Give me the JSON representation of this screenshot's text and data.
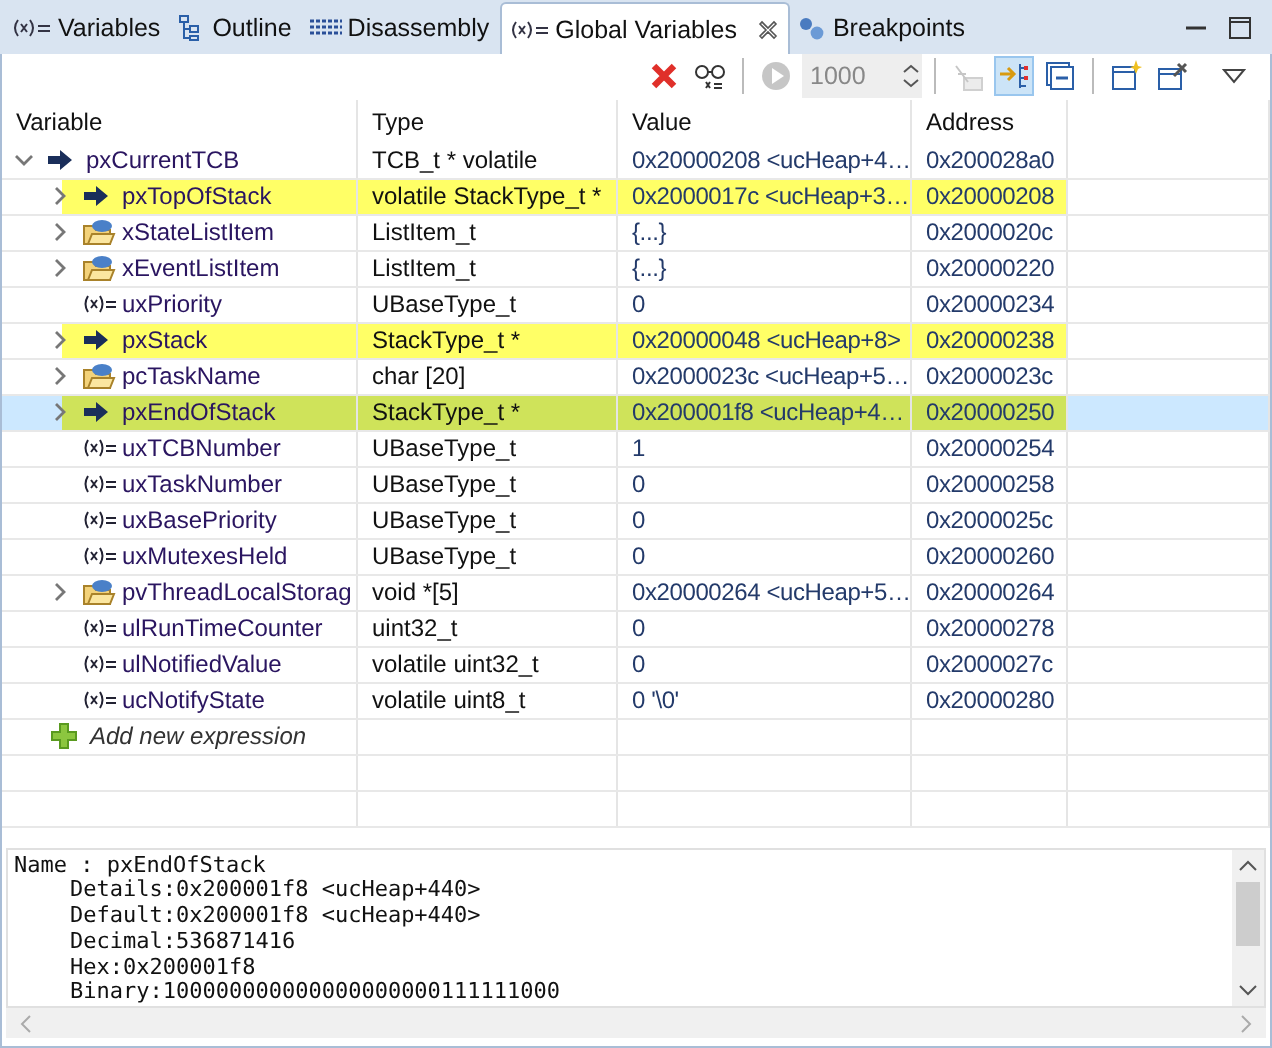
{
  "tabs": [
    {
      "label": "Variables",
      "selected": false
    },
    {
      "label": "Outline",
      "selected": false
    },
    {
      "label": "Disassembly",
      "selected": false
    },
    {
      "label": "Global Variables",
      "selected": true
    },
    {
      "label": "Breakpoints",
      "selected": false
    }
  ],
  "toolbar": {
    "groups": [
      [
        {
          "kind": "remove",
          "disabled": false
        },
        {
          "kind": "watch",
          "disabled": false
        }
      ],
      [
        {
          "kind": "play",
          "disabled": true
        },
        {
          "kind": "spinner",
          "value": "1000",
          "disabled": true
        }
      ],
      [
        {
          "kind": "filter",
          "disabled": true
        },
        {
          "kind": "layout",
          "disabled": false,
          "on": true
        },
        {
          "kind": "collapse",
          "disabled": false,
          "on": false
        }
      ],
      [
        {
          "kind": "new",
          "disabled": false
        },
        {
          "kind": "pin",
          "disabled": false
        }
      ]
    ]
  },
  "table": {
    "columns": [
      "Variable",
      "Type",
      "Value",
      "Address"
    ],
    "rows": [
      {
        "name": "pxCurrentTCB",
        "type": "TCB_t * volatile",
        "value": "0x20000208 <ucHeap+4…",
        "address": "0x200028a0",
        "kind": "pointer",
        "expanded": true,
        "selected": false,
        "children": [
          {
            "name": "pxTopOfStack",
            "type": "volatile StackType_t *",
            "value": "0x2000017c <ucHeap+3…",
            "address": "0x20000208",
            "kind": "pointer",
            "expanded": false,
            "selected": false,
            "color": "#ffff66"
          },
          {
            "name": "xStateListItem",
            "type": "ListItem_t",
            "value": "{...}",
            "address": "0x2000020c",
            "kind": "struct",
            "expanded": false,
            "selected": false
          },
          {
            "name": "xEventListItem",
            "type": "ListItem_t",
            "value": "{...}",
            "address": "0x20000220",
            "kind": "struct",
            "expanded": false,
            "selected": false
          },
          {
            "name": "uxPriority",
            "type": "UBaseType_t",
            "value": "0",
            "address": "0x20000234",
            "kind": "scalar",
            "selected": false
          },
          {
            "name": "pxStack",
            "type": "StackType_t *",
            "value": "0x20000048 <ucHeap+8>",
            "address": "0x20000238",
            "kind": "pointer",
            "expanded": false,
            "selected": false,
            "color": "#ffff66"
          },
          {
            "name": "pcTaskName",
            "type": "char [20]",
            "value": "0x2000023c <ucHeap+5…",
            "address": "0x2000023c",
            "kind": "struct",
            "expanded": false,
            "selected": false
          },
          {
            "name": "pxEndOfStack",
            "type": "StackType_t *",
            "value": "0x200001f8 <ucHeap+4…",
            "address": "0x20000250",
            "kind": "pointer",
            "expanded": false,
            "selected": true,
            "color": "#cfe35a"
          },
          {
            "name": "uxTCBNumber",
            "type": "UBaseType_t",
            "value": "1",
            "address": "0x20000254",
            "kind": "scalar",
            "selected": false
          },
          {
            "name": "uxTaskNumber",
            "type": "UBaseType_t",
            "value": "0",
            "address": "0x20000258",
            "kind": "scalar",
            "selected": false
          },
          {
            "name": "uxBasePriority",
            "type": "UBaseType_t",
            "value": "0",
            "address": "0x2000025c",
            "kind": "scalar",
            "selected": false
          },
          {
            "name": "uxMutexesHeld",
            "type": "UBaseType_t",
            "value": "0",
            "address": "0x20000260",
            "kind": "scalar",
            "selected": false
          },
          {
            "name": "pvThreadLocalStorag",
            "type": "void *[5]",
            "value": "0x20000264 <ucHeap+5…",
            "address": "0x20000264",
            "kind": "struct",
            "expanded": false,
            "selected": false
          },
          {
            "name": "ulRunTimeCounter",
            "type": "uint32_t",
            "value": "0",
            "address": "0x20000278",
            "kind": "scalar",
            "selected": false
          },
          {
            "name": "ulNotifiedValue",
            "type": "volatile uint32_t",
            "value": "0",
            "address": "0x2000027c",
            "kind": "scalar",
            "selected": false
          },
          {
            "name": "ucNotifyState",
            "type": "volatile uint8_t",
            "value": "0 '\\0'",
            "address": "0x20000280",
            "kind": "scalar",
            "selected": false
          }
        ]
      }
    ],
    "add_expression": "Add new expression"
  },
  "details": {
    "lines": [
      "Name : pxEndOfStack",
      "Details:0x200001f8 <ucHeap+440>",
      "Default:0x200001f8 <ucHeap+440>",
      "Decimal:536871416",
      "Hex:0x200001f8",
      "Binary:100000000000000000000111111000"
    ]
  }
}
